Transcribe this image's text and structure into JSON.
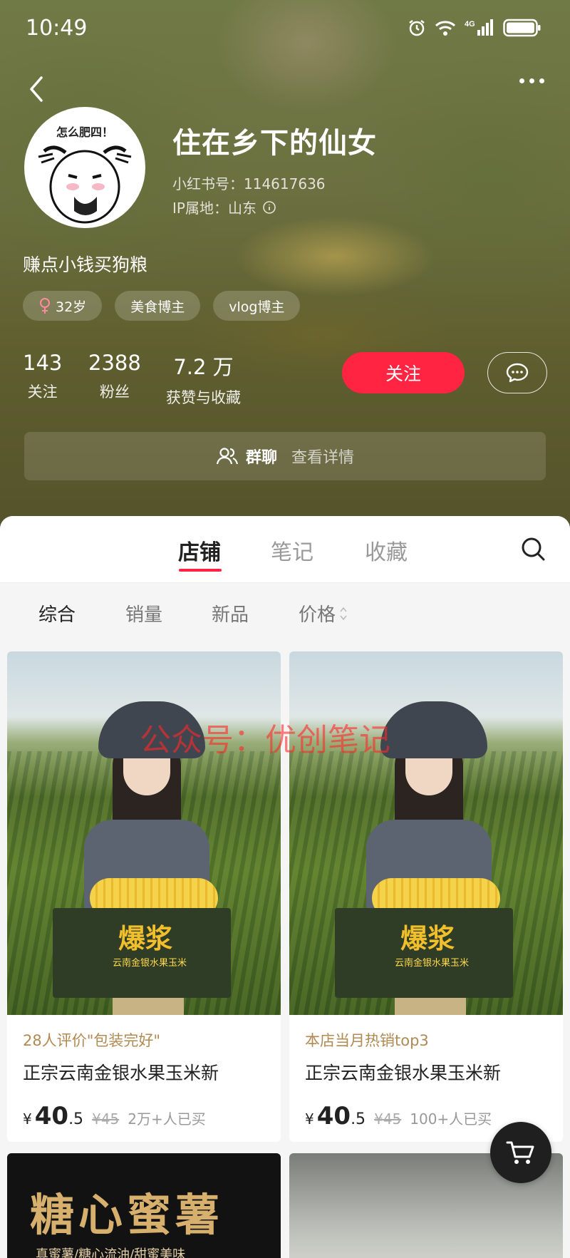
{
  "status_bar": {
    "time": "10:49"
  },
  "profile": {
    "avatar_caption": "怎么肥四！",
    "name": "住在乡下的仙女",
    "xhs_id": "小红书号：114617636",
    "ip": "IP属地：山东",
    "bio": "赚点小钱买狗粮",
    "tags": [
      "32岁",
      "美食博主",
      "vlog博主"
    ]
  },
  "stats": [
    {
      "value": "143",
      "label": "关注"
    },
    {
      "value": "2388",
      "label": "粉丝"
    },
    {
      "value": "7.2 万",
      "label": "获赞与收藏"
    }
  ],
  "actions": {
    "follow": "关注"
  },
  "group_chat": {
    "title": "群聊",
    "sub": "查看详情"
  },
  "tabs": [
    "店铺",
    "笔记",
    "收藏"
  ],
  "filters": [
    "综合",
    "销量",
    "新品",
    "价格"
  ],
  "watermark": "公众号：优创笔记",
  "products": [
    {
      "note": "28人评价\"包装完好\"",
      "title": "正宗云南金银水果玉米新",
      "currency": "¥",
      "price_int": "40",
      "price_dec": ".5",
      "orig_price": "¥45",
      "sold": "2万+人已买",
      "box_brand": "爆浆",
      "box_sub": "云南金银水果玉米"
    },
    {
      "note": "本店当月热销top3",
      "title": "正宗云南金银水果玉米新",
      "currency": "¥",
      "price_int": "40",
      "price_dec": ".5",
      "orig_price": "¥45",
      "sold": "100+人已买",
      "box_brand": "爆浆",
      "box_sub": "云南金银水果玉米"
    }
  ],
  "partial_products": [
    {
      "big_text": "糖心蜜薯",
      "small_text": "真蜜薯/糖心流油/甜蜜美味"
    }
  ],
  "colors": {
    "accent": "#ff2442",
    "note": "#b08a52"
  },
  "icons": [
    "back-arrow-icon",
    "more-icon",
    "alarm-icon",
    "wifi-icon",
    "signal-4g-icon",
    "battery-icon",
    "female-icon",
    "chat-bubble-icon",
    "group-icon",
    "search-icon",
    "sort-icon",
    "cart-icon",
    "info-icon"
  ]
}
